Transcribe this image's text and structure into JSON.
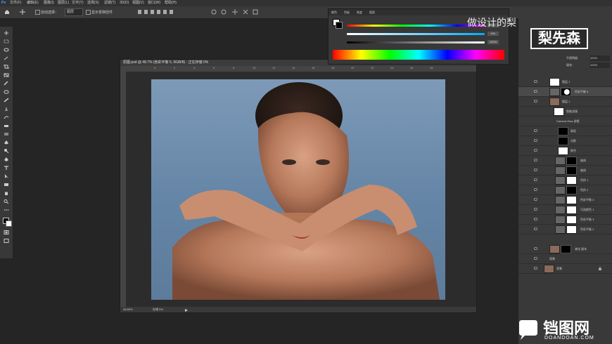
{
  "menubar": {
    "items": [
      "文件(F)",
      "编辑(E)",
      "图像(I)",
      "图层(L)",
      "文字(Y)",
      "选择(S)",
      "滤镜(T)",
      "3D(D)",
      "视图(V)",
      "窗口(W)",
      "帮助(H)"
    ]
  },
  "options_bar": {
    "auto_select_label": "自动选择：",
    "auto_select_value": "图层",
    "transform_label": "显示变换控件"
  },
  "document": {
    "title": "原图.psd @ 48.7% (色彩平衡 5, RGB/8) · 正在存储 0%",
    "ruler_ticks": [
      "0",
      "2",
      "4",
      "6",
      "8",
      "10",
      "12",
      "14",
      "16",
      "18",
      "20",
      "22",
      "24",
      "26",
      "28"
    ],
    "zoom_status": "48.66%",
    "doc_status": "存储 0%"
  },
  "color_panel": {
    "tabs": [
      "颜色",
      "色板",
      "渐变",
      "图案"
    ],
    "sliders": [
      {
        "value": "5",
        "unit": "%"
      },
      {
        "value": "0",
        "unit": "%"
      },
      {
        "value": "100",
        "unit": "%"
      }
    ]
  },
  "layers_panel": {
    "opacity_label": "不透明度:",
    "opacity_value": "100%",
    "fill_label": "填充:",
    "fill_value": "100%",
    "layers": [
      {
        "name": "图层 1"
      },
      {
        "name": "色彩平衡 5"
      },
      {
        "name": "图层 1"
      },
      {
        "name": "智能滤镜"
      },
      {
        "name": "Camera Raw 滤镜"
      },
      {
        "name": "高低"
      },
      {
        "name": "光影"
      },
      {
        "name": "肤色"
      },
      {
        "name": "曲线"
      },
      {
        "name": "曲线"
      },
      {
        "name": "色阶 1"
      },
      {
        "name": "色阶 2"
      },
      {
        "name": "色彩平衡 4"
      },
      {
        "name": "可选颜色 1"
      },
      {
        "name": "色彩平衡 3"
      },
      {
        "name": "色彩平衡 2"
      },
      {
        "name": "液化 副本"
      },
      {
        "name": "背景"
      },
      {
        "name": "背景"
      }
    ]
  },
  "watermarks": {
    "top_text": "做设计的梨",
    "badge_text": "梨先森",
    "site_cn": "铛图网",
    "site_en": "DOANDOAN.COM"
  }
}
